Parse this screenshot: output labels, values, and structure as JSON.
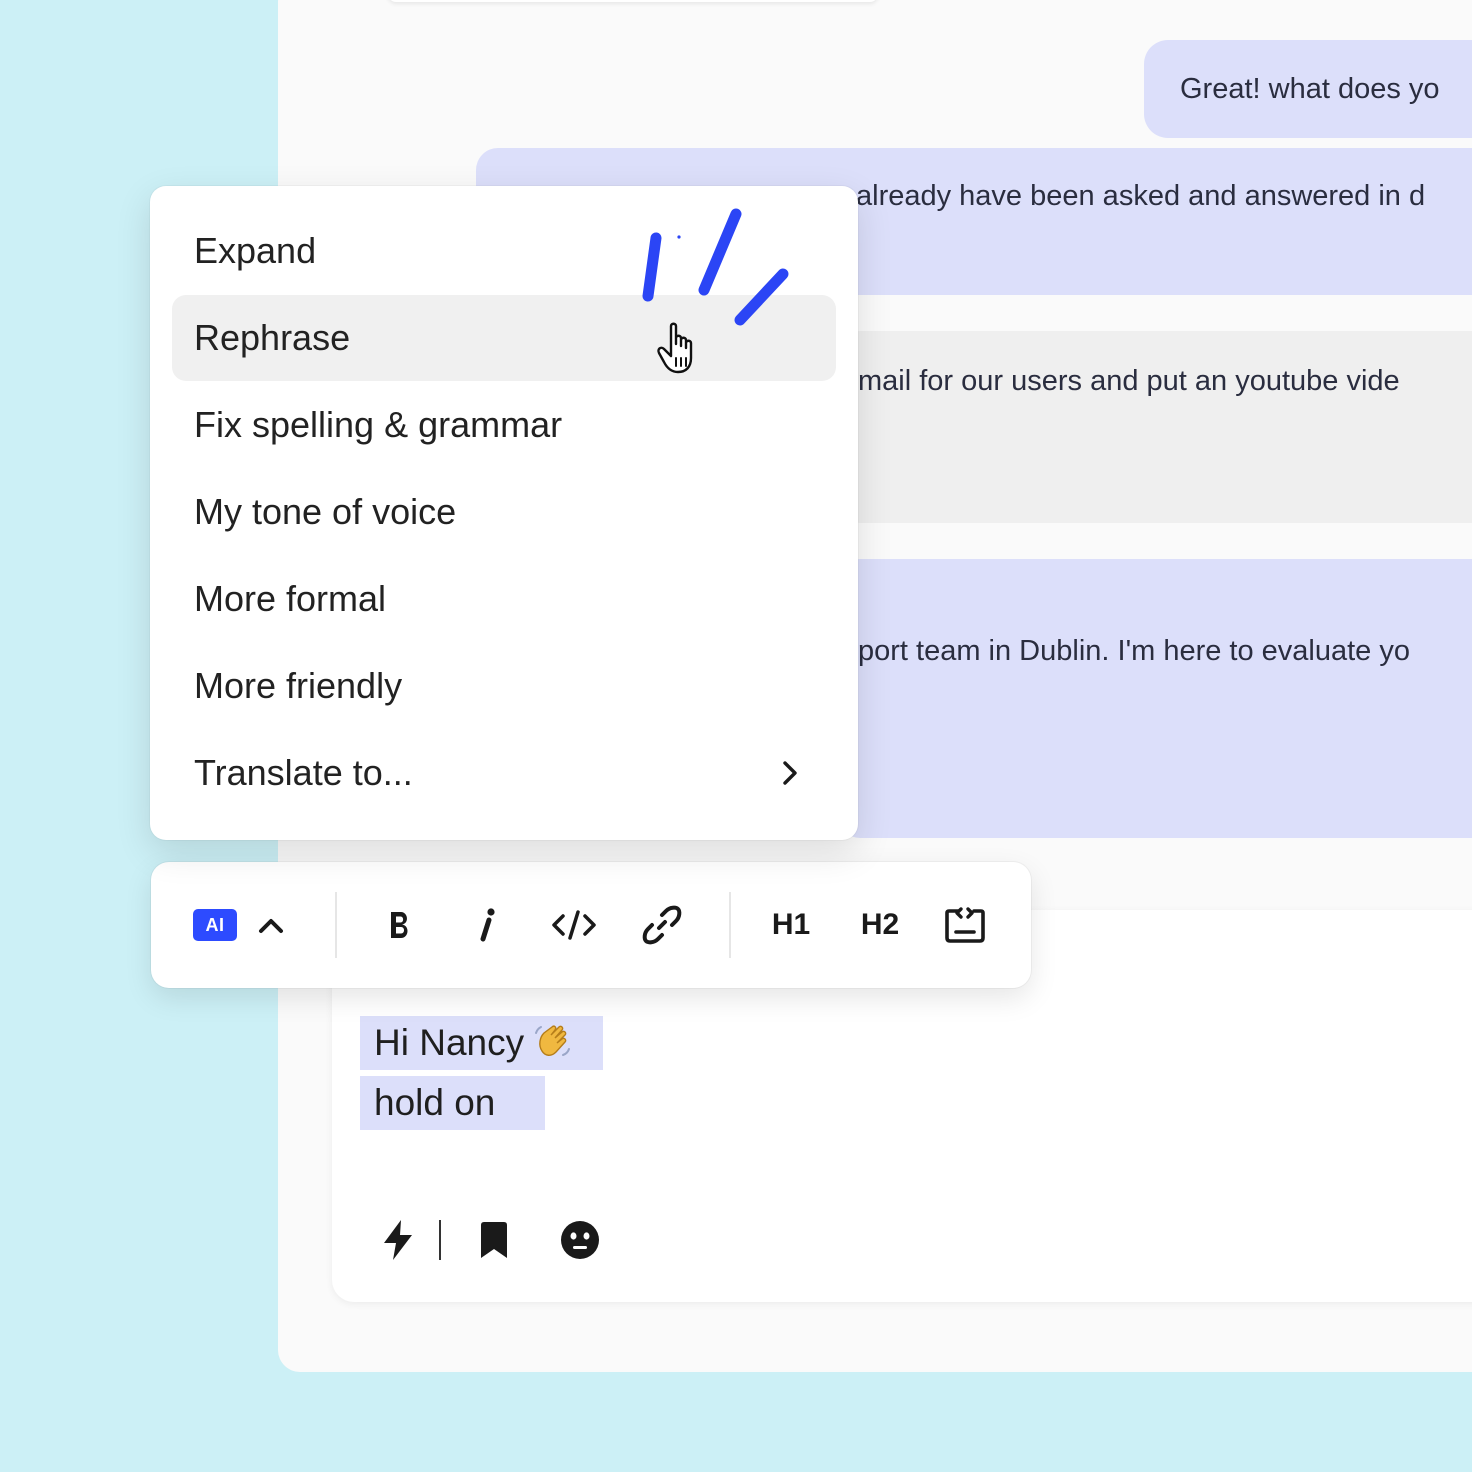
{
  "conversation": {
    "messages": [
      {
        "text": "Great! what does yo"
      },
      {
        "text": "already have been asked and answered in d"
      },
      {
        "text": "mail for our users and put an youtube vide"
      },
      {
        "text": "port team in Dublin. I'm here to evaluate yo"
      }
    ]
  },
  "ai_menu": {
    "items": [
      {
        "label": "Expand"
      },
      {
        "label": "Rephrase"
      },
      {
        "label": "Fix spelling & grammar"
      },
      {
        "label": "My tone of voice"
      },
      {
        "label": "More formal"
      },
      {
        "label": "More friendly"
      },
      {
        "label": "Translate to..."
      }
    ],
    "hovered": "Rephrase"
  },
  "toolbar": {
    "ai_label": "AI",
    "h1_label": "H1",
    "h2_label": "H2"
  },
  "composer": {
    "lines": [
      "Hi Nancy",
      "hold on"
    ]
  },
  "colors": {
    "background": "#ccf0f6",
    "bubble": "#dcdffa",
    "accent": "#2d4bff",
    "scribble": "#2b45f5"
  }
}
